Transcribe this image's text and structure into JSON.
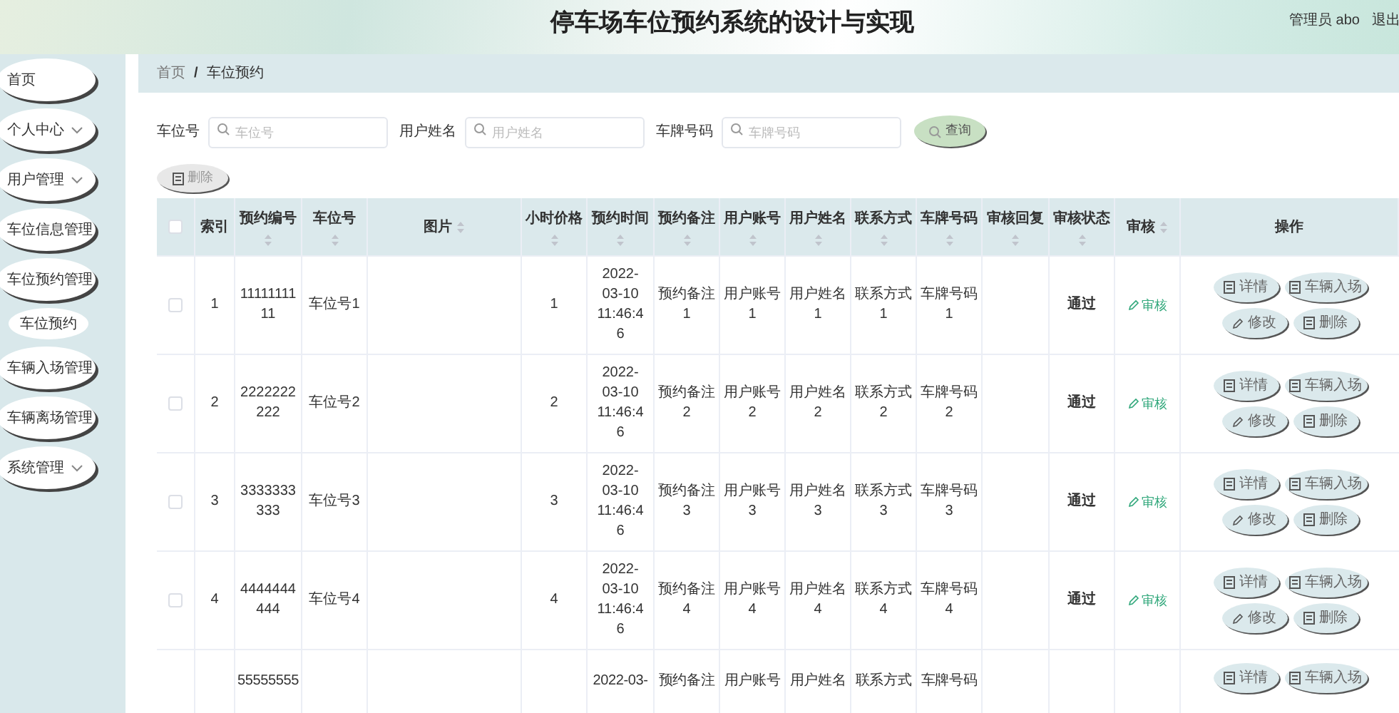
{
  "header": {
    "title": "停车场车位预约系统的设计与实现",
    "user": "管理员 abo",
    "logout": "退出"
  },
  "sidebar": {
    "items": [
      {
        "label": "首页",
        "expandable": false
      },
      {
        "label": "个人中心",
        "expandable": true
      },
      {
        "label": "用户管理",
        "expandable": true
      },
      {
        "label": "车位信息管理",
        "expandable": false
      },
      {
        "label": "车位预约管理",
        "expandable": false,
        "children": [
          {
            "label": "车位预约"
          }
        ]
      },
      {
        "label": "车辆入场管理",
        "expandable": false
      },
      {
        "label": "车辆离场管理",
        "expandable": false
      },
      {
        "label": "系统管理",
        "expandable": true
      }
    ]
  },
  "breadcrumb": {
    "items": [
      "首页",
      "车位预约"
    ],
    "separator": "/"
  },
  "search": {
    "fields": [
      {
        "label": "车位号",
        "placeholder": "车位号"
      },
      {
        "label": "用户姓名",
        "placeholder": "用户姓名"
      },
      {
        "label": "车牌号码",
        "placeholder": "车牌号码"
      }
    ],
    "button": "查询"
  },
  "delete_button": "删除",
  "table": {
    "select_all": {
      "checked": false
    },
    "columns": [
      {
        "label": "索引",
        "sortable": false
      },
      {
        "label": "预约编号",
        "sortable": true,
        "sort_beside": false
      },
      {
        "label": "车位号",
        "sortable": true,
        "sort_beside": false
      },
      {
        "label": "图片",
        "sortable": true,
        "sort_beside": true
      },
      {
        "label": "小时价格",
        "sortable": true,
        "sort_beside": false
      },
      {
        "label": "预约时间",
        "sortable": true,
        "sort_beside": false
      },
      {
        "label": "预约备注",
        "sortable": true,
        "sort_beside": false
      },
      {
        "label": "用户账号",
        "sortable": true,
        "sort_beside": false
      },
      {
        "label": "用户姓名",
        "sortable": true,
        "sort_beside": false
      },
      {
        "label": "联系方式",
        "sortable": true,
        "sort_beside": false
      },
      {
        "label": "车牌号码",
        "sortable": true,
        "sort_beside": false
      },
      {
        "label": "审核回复",
        "sortable": true,
        "sort_beside": false
      },
      {
        "label": "审核状态",
        "sortable": true,
        "sort_beside": false
      },
      {
        "label": "审核",
        "sortable": true,
        "sort_beside": true
      },
      {
        "label": "操作",
        "sortable": false
      }
    ],
    "rows": [
      {
        "checked": false,
        "index": "1",
        "reservation_no": "1111111111",
        "spot": "车位号1",
        "price": "1",
        "time": "2022-03-10 11:46:46",
        "remark": "预约备注1",
        "account": "用户账号1",
        "name": "用户姓名1",
        "contact": "联系方式1",
        "plate": "车牌号码1",
        "status": "通过",
        "review": "审核",
        "actions": [
          "详情",
          "车辆入场",
          "修改",
          "删除"
        ]
      },
      {
        "checked": false,
        "index": "2",
        "reservation_no": "2222222222",
        "spot": "车位号2",
        "price": "2",
        "time": "2022-03-10 11:46:46",
        "remark": "预约备注2",
        "account": "用户账号2",
        "name": "用户姓名2",
        "contact": "联系方式2",
        "plate": "车牌号码2",
        "status": "通过",
        "review": "审核",
        "actions": [
          "详情",
          "车辆入场",
          "修改",
          "删除"
        ]
      },
      {
        "checked": false,
        "index": "3",
        "reservation_no": "3333333333",
        "spot": "车位号3",
        "price": "3",
        "time": "2022-03-10 11:46:46",
        "remark": "预约备注3",
        "account": "用户账号3",
        "name": "用户姓名3",
        "contact": "联系方式3",
        "plate": "车牌号码3",
        "status": "通过",
        "review": "审核",
        "actions": [
          "详情",
          "车辆入场",
          "修改",
          "删除"
        ]
      },
      {
        "checked": false,
        "index": "4",
        "reservation_no": "4444444444",
        "spot": "车位号4",
        "price": "4",
        "time": "2022-03-10 11:46:46",
        "remark": "预约备注4",
        "account": "用户账号4",
        "name": "用户姓名4",
        "contact": "联系方式4",
        "plate": "车牌号码4",
        "status": "通过",
        "review": "审核",
        "actions": [
          "详情",
          "车辆入场",
          "修改",
          "删除"
        ]
      },
      {
        "reservation_no": "55555555",
        "time": "2022-03-",
        "remark": "预约备注",
        "account": "用户账号",
        "name": "用户姓名",
        "contact": "联系方式",
        "plate": "车牌号码",
        "actions": [
          "详情",
          "车辆入场"
        ]
      }
    ]
  }
}
